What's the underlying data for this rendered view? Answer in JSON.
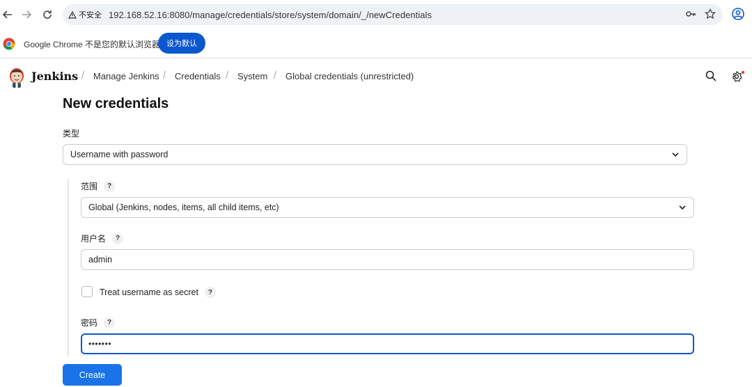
{
  "browser": {
    "security_label": "不安全",
    "url": "192.168.52.16:8080/manage/credentials/store/system/domain/_/newCredentials"
  },
  "infobar": {
    "message": "Google Chrome 不是您的默认浏览器",
    "set_default_label": "设为默认"
  },
  "header": {
    "app_name": "Jenkins",
    "breadcrumbs": [
      "Manage Jenkins",
      "Credentials",
      "System",
      "Global credentials (unrestricted)"
    ]
  },
  "page": {
    "title": "New credentials"
  },
  "form": {
    "kind_label": "类型",
    "kind_value": "Username with password",
    "scope_label": "范围",
    "scope_value": "Global (Jenkins, nodes, items, all child items, etc)",
    "username_label": "用户名",
    "username_value": "admin",
    "secret_label": "Treat username as secret",
    "password_label": "密码",
    "password_value": "•••••••",
    "help_glyph": "?"
  },
  "actions": {
    "create_label": "Create"
  },
  "colors": {
    "accent": "#1a73e8",
    "chrome_blue": "#0b57d0"
  }
}
